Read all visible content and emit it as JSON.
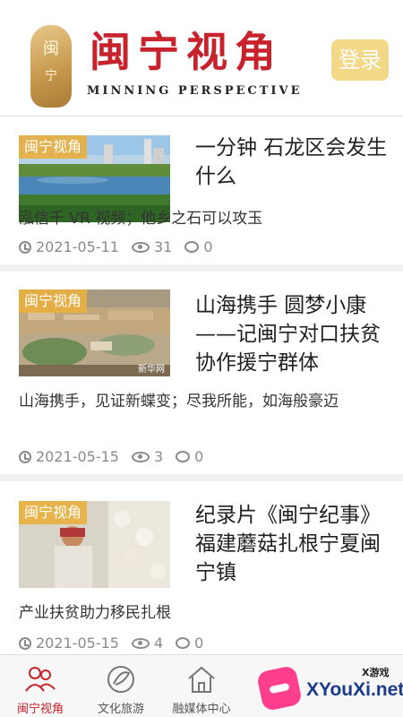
{
  "header": {
    "seal_text_top": "闽",
    "seal_text_bottom": "宁",
    "title": "闽宁视角",
    "subtitle": "MINNING  PERSPECTIVE",
    "login_label": "登录",
    "login_color": "#f2d887",
    "brand_color": "#c8232c"
  },
  "articles": [
    {
      "thumb_tag": "闽宁视角",
      "thumb_watermark": "",
      "title": "一分钟 石龙区会发生什么",
      "summary": "泓信千 VR 视频；他乡之石可以攻玉",
      "date": "2021-05-11",
      "views": "31",
      "comments": "0"
    },
    {
      "thumb_tag": "闽宁视角",
      "thumb_watermark": "新华网",
      "title": "山海携手 圆梦小康——记闽宁对口扶贫协作援宁群体",
      "summary": "山海携手，见证新蝶变；尽我所能，如海般豪迈",
      "date": "2021-05-15",
      "views": "3",
      "comments": "0"
    },
    {
      "thumb_tag": "闽宁视角",
      "thumb_watermark": "",
      "title": "纪录片《闽宁纪事》 福建蘑菇扎根宁夏闽宁镇",
      "summary": "产业扶贫助力移民扎根",
      "date": "2021-05-15",
      "views": "4",
      "comments": "0"
    }
  ],
  "tabbar": {
    "tabs": [
      {
        "label": "闽宁视角",
        "icon": "people-icon",
        "active": true
      },
      {
        "label": "文化旅游",
        "icon": "leaf-badge-icon",
        "active": false
      },
      {
        "label": "融媒体中心",
        "icon": "home-icon",
        "active": false
      },
      {
        "label": "",
        "icon": "hidden-icon",
        "active": false
      },
      {
        "label": "",
        "icon": "hidden-icon",
        "active": false
      }
    ],
    "active_color": "#c8232c"
  },
  "watermark": {
    "small": "X游戏",
    "text": "XYouXi.net"
  }
}
